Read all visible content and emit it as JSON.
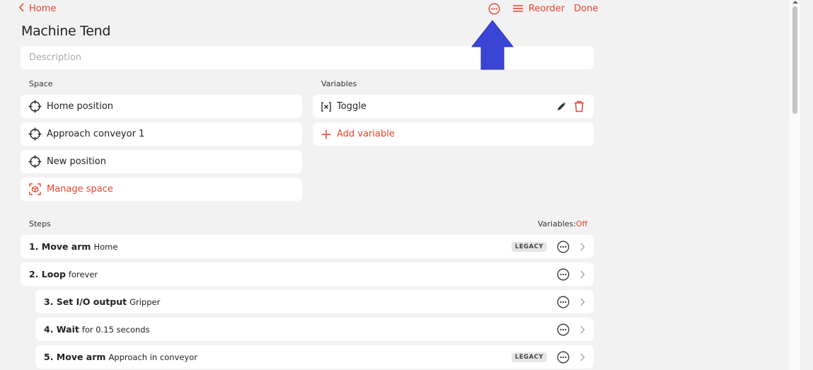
{
  "nav": {
    "back_label": "Home"
  },
  "toolbar": {
    "reorder_label": "Reorder",
    "done_label": "Done"
  },
  "title": "Machine Tend",
  "description": {
    "placeholder": "Description"
  },
  "space": {
    "label": "Space",
    "items": [
      {
        "label": "Home position",
        "icon": "crosshair-icon"
      },
      {
        "label": "Approach conveyor 1",
        "icon": "crosshair-icon"
      },
      {
        "label": "New position",
        "icon": "crosshair-icon"
      }
    ],
    "manage_label": "Manage space"
  },
  "variables": {
    "label": "Variables",
    "items": [
      {
        "label": "Toggle",
        "icon": "variable-x-icon"
      }
    ],
    "add_label": "Add variable"
  },
  "steps": {
    "label": "Steps",
    "variables_toggle_label": "Variables:",
    "variables_toggle_value": "Off",
    "items": [
      {
        "name": "1. Move arm",
        "detail": "Home",
        "legacy": true,
        "indent": false
      },
      {
        "name": "2. Loop",
        "detail": "forever",
        "legacy": false,
        "indent": false
      },
      {
        "name": "3. Set I/O output",
        "detail": "Gripper",
        "legacy": false,
        "indent": true
      },
      {
        "name": "4. Wait",
        "detail": "for 0.15 seconds",
        "legacy": false,
        "indent": true
      },
      {
        "name": "5. Move arm",
        "detail": "Approach in conveyor",
        "legacy": true,
        "indent": true
      }
    ],
    "legacy_label": "LEGACY"
  },
  "colors": {
    "accent": "#e8432e",
    "background": "#f2f2f2",
    "card": "#ffffff",
    "pointer": "#3a45d6"
  }
}
